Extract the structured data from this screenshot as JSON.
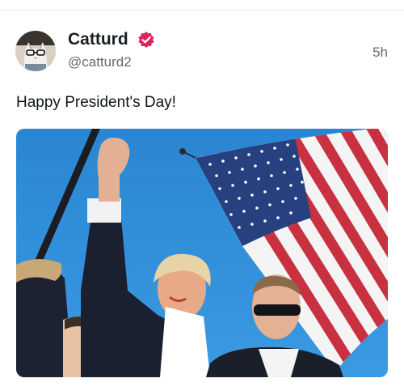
{
  "post": {
    "author": {
      "name": "Catturd",
      "handle": "@catturd2",
      "verified": true,
      "verified_color": "#e0245e"
    },
    "timestamp": "5h",
    "text": "Happy President's Day!",
    "media": {
      "type": "photo",
      "alt": "Raised fist in front of an American flag against a blue sky"
    }
  },
  "icons": {
    "verified": "verified-badge-icon",
    "avatar": "cat-with-glasses-avatar"
  },
  "colors": {
    "sky": "#2f8fd8",
    "flag_red": "#c8313f",
    "flag_blue": "#27407f",
    "text_secondary": "#606a75"
  }
}
